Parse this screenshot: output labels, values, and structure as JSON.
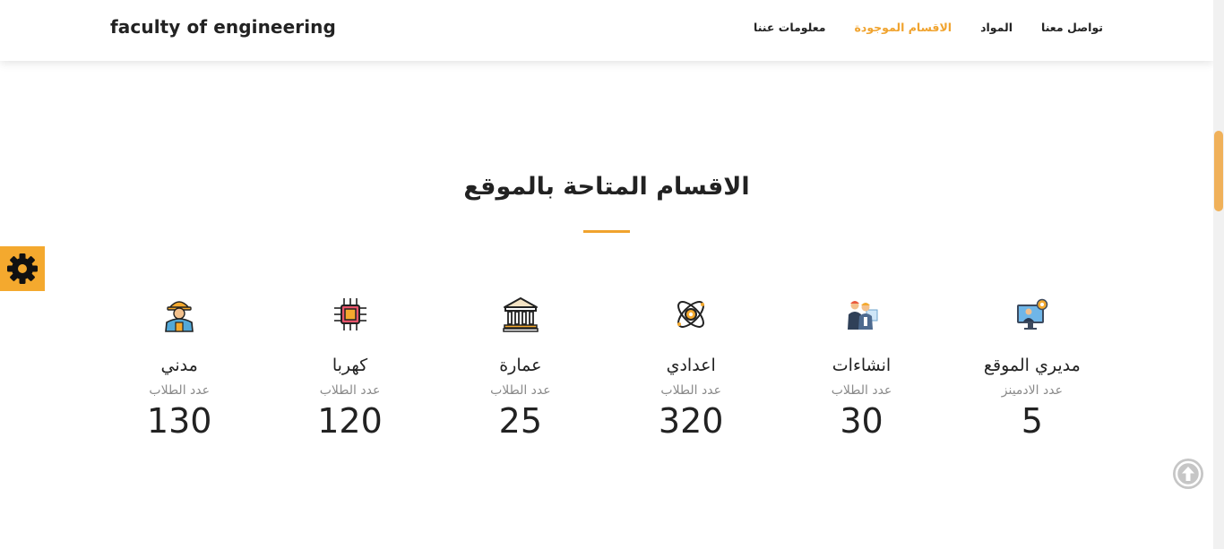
{
  "header": {
    "brand": "faculty of engineering",
    "nav": [
      {
        "label": "تواصل معنا",
        "active": false
      },
      {
        "label": "المواد",
        "active": false
      },
      {
        "label": "الاقسام الموجودة",
        "active": true
      },
      {
        "label": "معلومات عننا",
        "active": false
      }
    ]
  },
  "main": {
    "title": "الاقسام المتاحة بالموقع",
    "stats": [
      {
        "name": "مديري الموقع",
        "label": "عدد الادمينز",
        "value": "5",
        "icon": "admin-computer-icon"
      },
      {
        "name": "انشاءات",
        "label": "عدد الطلاب",
        "value": "30",
        "icon": "construction-engineers-icon"
      },
      {
        "name": "اعدادي",
        "label": "عدد الطلاب",
        "value": "320",
        "icon": "atom-icon"
      },
      {
        "name": "عمارة",
        "label": "عدد الطلاب",
        "value": "25",
        "icon": "building-columns-icon"
      },
      {
        "name": "كهربا",
        "label": "عدد الطلاب",
        "value": "120",
        "icon": "microchip-icon"
      },
      {
        "name": "مدني",
        "label": "عدد الطلاب",
        "value": "130",
        "icon": "civil-worker-icon"
      }
    ]
  },
  "widgets": {
    "settings_icon": "gear-icon",
    "scroll_top_icon": "arrow-up-circle-icon"
  },
  "colors": {
    "accent": "#f0a32e",
    "text": "#222222",
    "muted": "#8a8a8a"
  }
}
